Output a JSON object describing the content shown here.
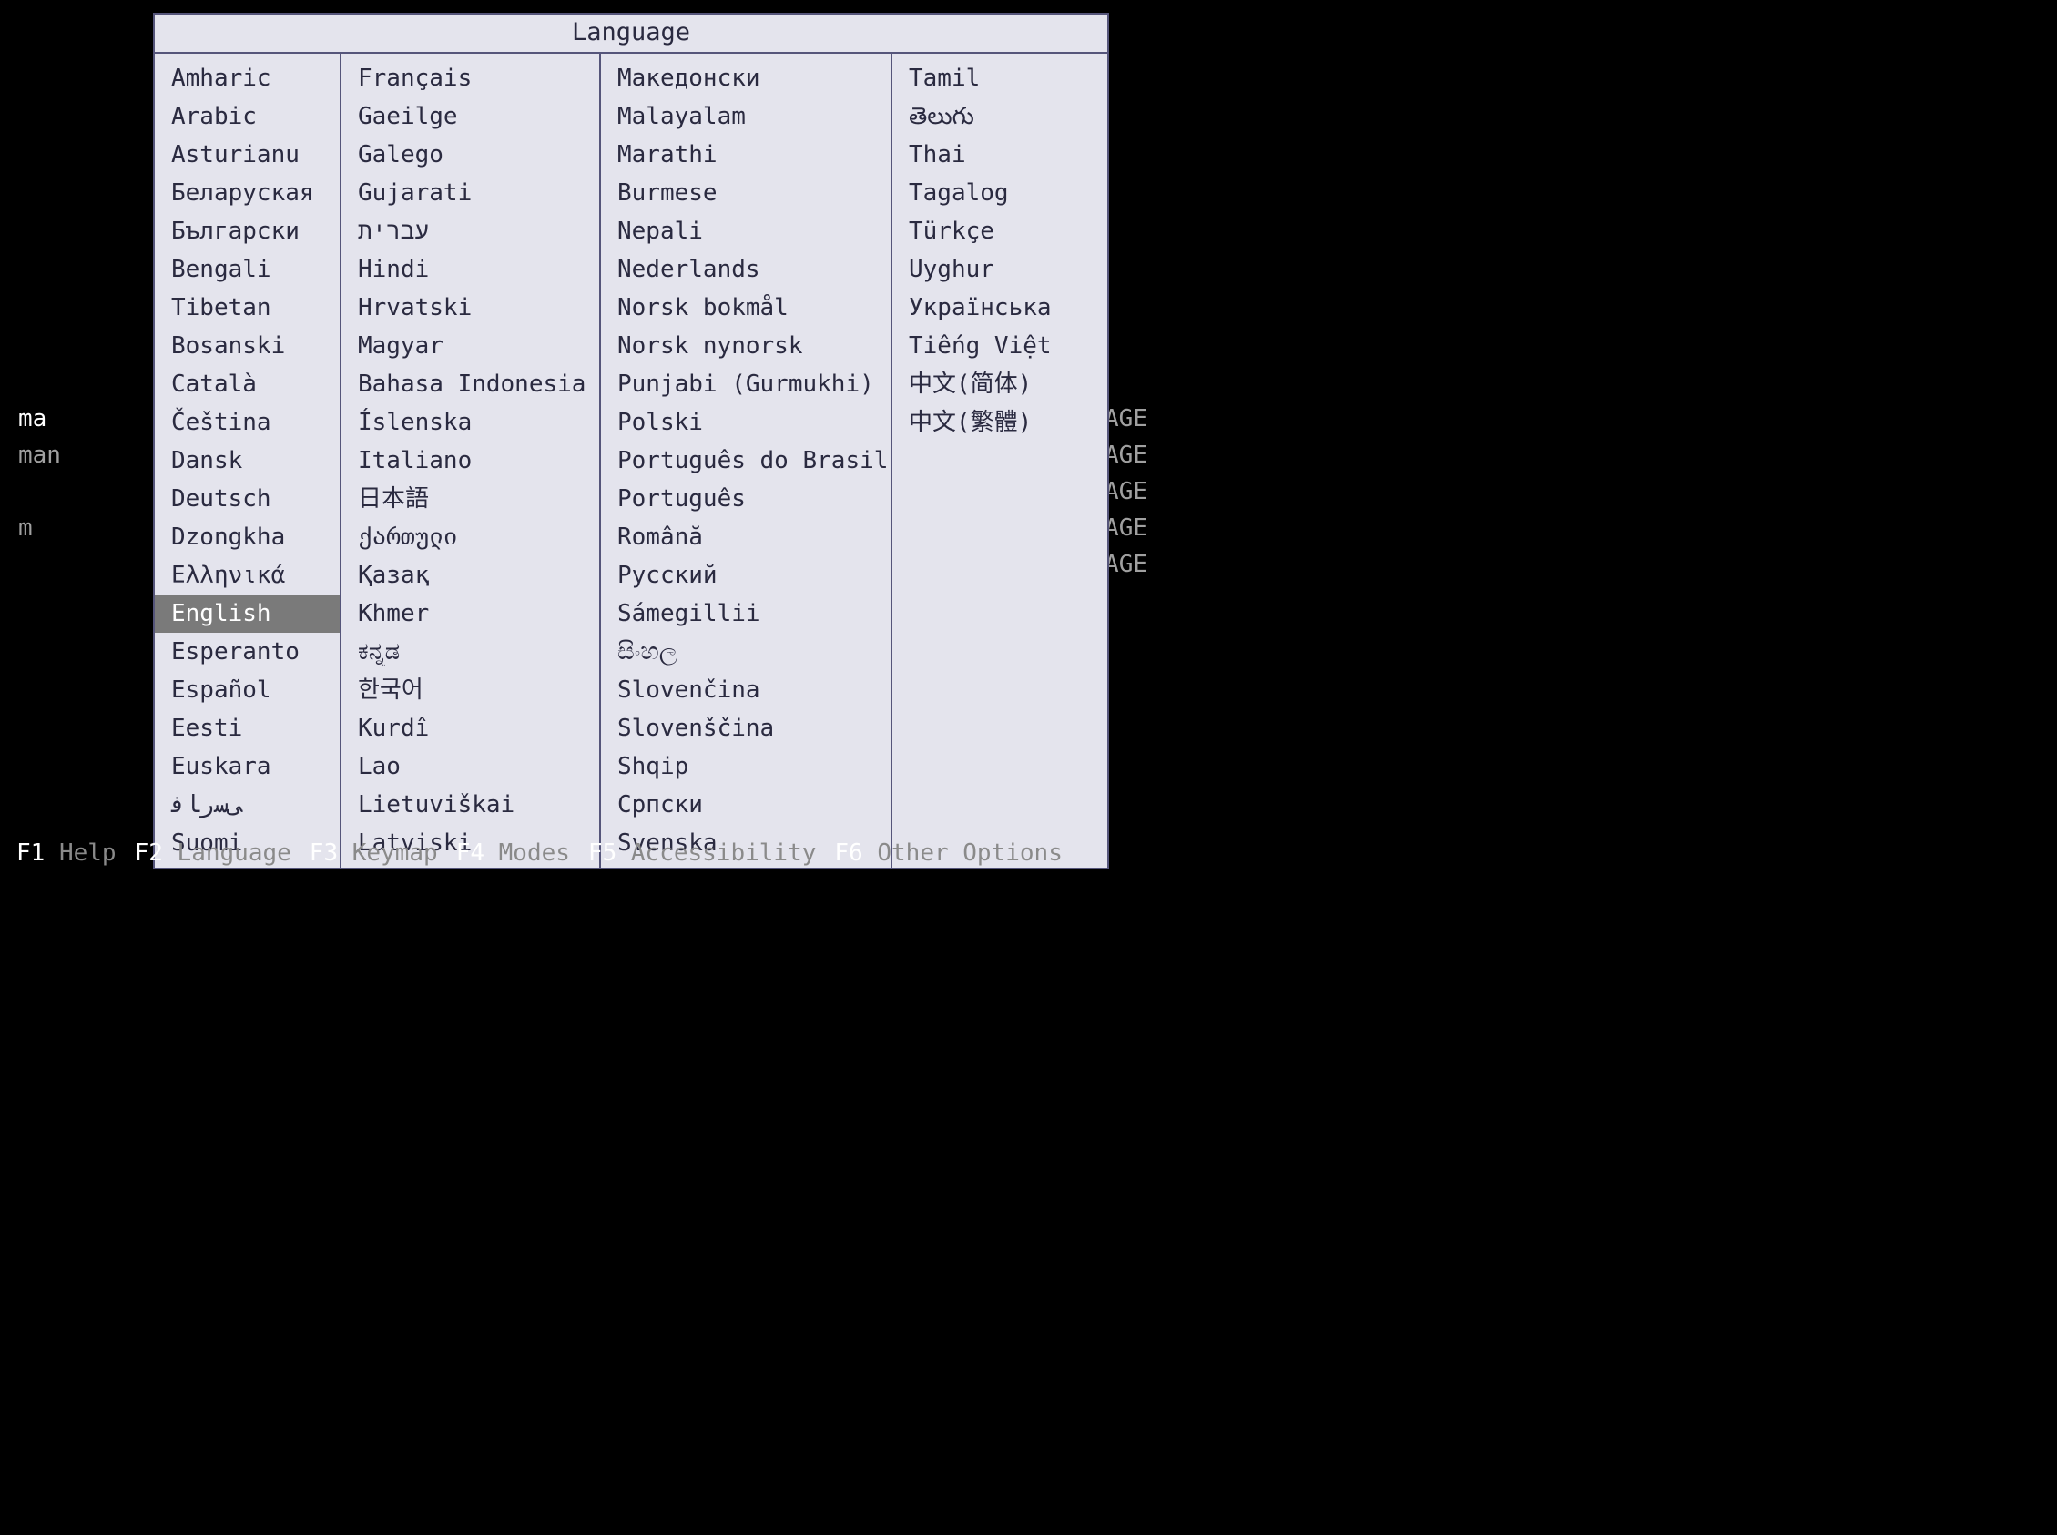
{
  "overlay": {
    "title": "Language",
    "selected": "English",
    "columns": [
      [
        "Amharic",
        "Arabic",
        "Asturianu",
        "Беларуская",
        "Български",
        "Bengali",
        "Tibetan",
        "Bosanski",
        "Català",
        "Čeština",
        "Dansk",
        "Deutsch",
        "Dzongkha",
        "Ελληνικά",
        "English",
        "Esperanto",
        "Español",
        "Eesti",
        "Euskara",
        "ﻰﺳﺭﺎﻓ",
        "Suomi"
      ],
      [
        "Français",
        "Gaeilge",
        "Galego",
        "Gujarati",
        "עברית",
        "Hindi",
        "Hrvatski",
        "Magyar",
        "Bahasa Indonesia",
        "Íslenska",
        "Italiano",
        "日本語",
        "ქართული",
        "Қазақ",
        "Khmer",
        "ಕನ್ನಡ",
        "한국어",
        "Kurdî",
        "Lao",
        "Lietuviškai",
        "Latviski"
      ],
      [
        "Македонски",
        "Malayalam",
        "Marathi",
        "Burmese",
        "Nepali",
        "Nederlands",
        "Norsk bokmål",
        "Norsk nynorsk",
        "Punjabi (Gurmukhi)",
        "Polski",
        "Português do Brasil",
        "Português",
        "Română",
        "Русский",
        "Sámegillii",
        "සිංහල",
        "Slovenčina",
        "Slovenščina",
        "Shqip",
        "Српски",
        "Svenska"
      ],
      [
        "Tamil",
        "తెలుగు",
        "Thai",
        "Tagalog",
        "Türkçe",
        "Uyghur",
        "Українська",
        "Tiếng Việt",
        "中文(简体)",
        "中文(繁體)"
      ]
    ]
  },
  "background_menu": [
    {
      "left": "ma",
      "right": "D STORAGE",
      "bright": true
    },
    {
      "left": "man",
      "right": "GB STORAGE",
      "bright": false
    },
    {
      "left": "",
      "right": "TORAGE",
      "bright": false
    },
    {
      "left": "m",
      "right": " STORAGE",
      "bright": false
    },
    {
      "left": "",
      "right": "TORAGE",
      "bright": false
    }
  ],
  "footer": [
    {
      "key": "F1",
      "label": "Help"
    },
    {
      "key": "F2",
      "label": "Language"
    },
    {
      "key": "F3",
      "label": "Keymap"
    },
    {
      "key": "F4",
      "label": "Modes"
    },
    {
      "key": "F5",
      "label": "Accessibility"
    },
    {
      "key": "F6",
      "label": "Other Options"
    }
  ]
}
